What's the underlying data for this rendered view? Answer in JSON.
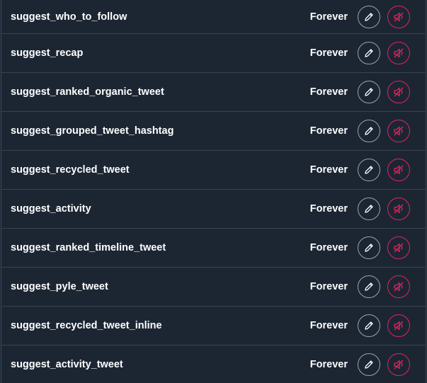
{
  "colors": {
    "background": "#1c2633",
    "divider": "#38444f",
    "text": "#ffffff",
    "edit_border": "#9aa3ad",
    "mute_accent": "#e0245e"
  },
  "icons": {
    "edit": "pencil-icon",
    "mute": "volume-mute-icon"
  },
  "rows": [
    {
      "name": "suggest_who_to_follow",
      "duration": "Forever"
    },
    {
      "name": "suggest_recap",
      "duration": "Forever"
    },
    {
      "name": "suggest_ranked_organic_tweet",
      "duration": "Forever"
    },
    {
      "name": "suggest_grouped_tweet_hashtag",
      "duration": "Forever"
    },
    {
      "name": "suggest_recycled_tweet",
      "duration": "Forever"
    },
    {
      "name": "suggest_activity",
      "duration": "Forever"
    },
    {
      "name": "suggest_ranked_timeline_tweet",
      "duration": "Forever"
    },
    {
      "name": "suggest_pyle_tweet",
      "duration": "Forever"
    },
    {
      "name": "suggest_recycled_tweet_inline",
      "duration": "Forever"
    },
    {
      "name": "suggest_activity_tweet",
      "duration": "Forever"
    }
  ]
}
